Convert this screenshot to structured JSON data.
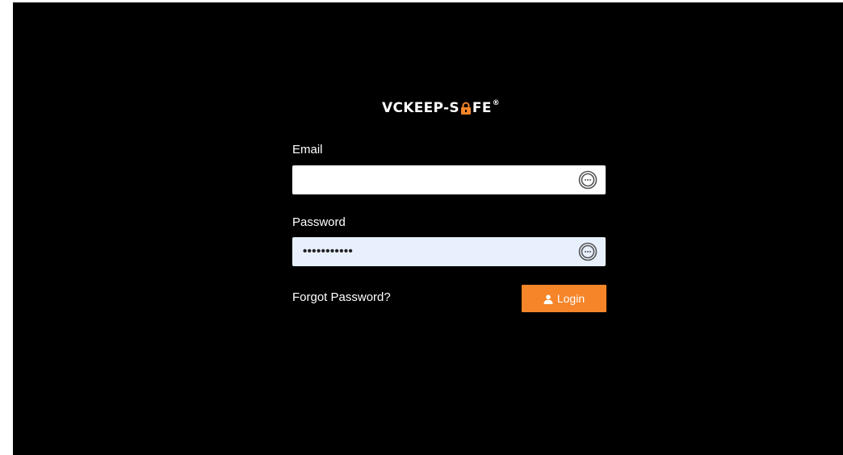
{
  "brand": {
    "name_part1": "VCKEEP-S",
    "name_part2": "FE",
    "registered_mark": "®",
    "accent_color": "#f6852a"
  },
  "form": {
    "email": {
      "label": "Email",
      "value": "",
      "background": "#ffffff",
      "autofill_icon": "password-manager-icon"
    },
    "password": {
      "label": "Password",
      "masked_value": "•••••••••••",
      "background": "#e8f0fe",
      "autofill_icon": "password-manager-icon"
    },
    "forgot_link": "Forgot Password?",
    "login_button": {
      "label": "Login",
      "icon": "user-icon",
      "color": "#f6852a"
    }
  }
}
